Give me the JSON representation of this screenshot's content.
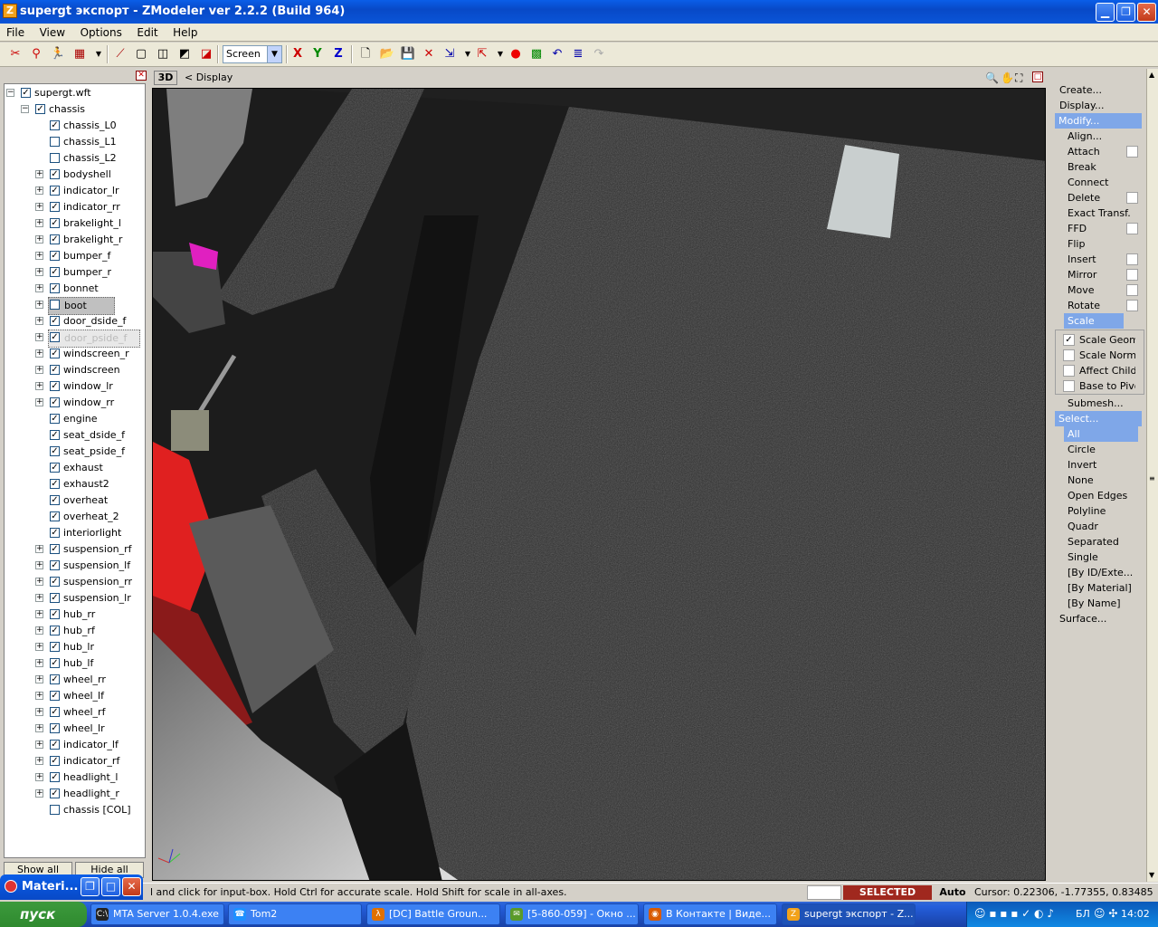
{
  "window": {
    "title": "supergt экспорт - ZModeler ver 2.2.2 (Build 964)",
    "icon_letter": "Z",
    "min_glyph": "▁",
    "max_glyph": "❐",
    "close_glyph": "✕"
  },
  "menu": [
    "File",
    "View",
    "Options",
    "Edit",
    "Help"
  ],
  "toolbar": {
    "view_select": "Screen",
    "axis_x": "X",
    "axis_y": "Y",
    "axis_z": "Z"
  },
  "tree": {
    "root": "supergt.wft",
    "chassis": "chassis",
    "items": [
      {
        "label": "chassis_L0",
        "checked": true,
        "expandable": false
      },
      {
        "label": "chassis_L1",
        "checked": false,
        "expandable": false
      },
      {
        "label": "chassis_L2",
        "checked": false,
        "expandable": false
      },
      {
        "label": "bodyshell",
        "checked": true,
        "expandable": true
      },
      {
        "label": "indicator_lr",
        "checked": true,
        "expandable": true
      },
      {
        "label": "indicator_rr",
        "checked": true,
        "expandable": true
      },
      {
        "label": "brakelight_l",
        "checked": true,
        "expandable": true
      },
      {
        "label": "brakelight_r",
        "checked": true,
        "expandable": true
      },
      {
        "label": "bumper_f",
        "checked": true,
        "expandable": true
      },
      {
        "label": "bumper_r",
        "checked": true,
        "expandable": true
      },
      {
        "label": "bonnet",
        "checked": true,
        "expandable": true
      },
      {
        "label": "boot",
        "checked": false,
        "expandable": true,
        "selected": true
      },
      {
        "label": "door_dside_f",
        "checked": true,
        "expandable": true
      },
      {
        "label": "door_pside_f",
        "checked": true,
        "expandable": true,
        "focused": true
      },
      {
        "label": "windscreen_r",
        "checked": true,
        "expandable": true
      },
      {
        "label": "windscreen",
        "checked": true,
        "expandable": true
      },
      {
        "label": "window_lr",
        "checked": true,
        "expandable": true
      },
      {
        "label": "window_rr",
        "checked": true,
        "expandable": true
      },
      {
        "label": "engine",
        "checked": true,
        "expandable": false
      },
      {
        "label": "seat_dside_f",
        "checked": true,
        "expandable": false
      },
      {
        "label": "seat_pside_f",
        "checked": true,
        "expandable": false
      },
      {
        "label": "exhaust",
        "checked": true,
        "expandable": false
      },
      {
        "label": "exhaust2",
        "checked": true,
        "expandable": false
      },
      {
        "label": "overheat",
        "checked": true,
        "expandable": false
      },
      {
        "label": "overheat_2",
        "checked": true,
        "expandable": false
      },
      {
        "label": "interiorlight",
        "checked": true,
        "expandable": false
      },
      {
        "label": "suspension_rf",
        "checked": true,
        "expandable": true
      },
      {
        "label": "suspension_lf",
        "checked": true,
        "expandable": true
      },
      {
        "label": "suspension_rr",
        "checked": true,
        "expandable": true
      },
      {
        "label": "suspension_lr",
        "checked": true,
        "expandable": true
      },
      {
        "label": "hub_rr",
        "checked": true,
        "expandable": true
      },
      {
        "label": "hub_rf",
        "checked": true,
        "expandable": true
      },
      {
        "label": "hub_lr",
        "checked": true,
        "expandable": true
      },
      {
        "label": "hub_lf",
        "checked": true,
        "expandable": true
      },
      {
        "label": "wheel_rr",
        "checked": true,
        "expandable": true
      },
      {
        "label": "wheel_lf",
        "checked": true,
        "expandable": true
      },
      {
        "label": "wheel_rf",
        "checked": true,
        "expandable": true
      },
      {
        "label": "wheel_lr",
        "checked": true,
        "expandable": true
      },
      {
        "label": "indicator_lf",
        "checked": true,
        "expandable": true
      },
      {
        "label": "indicator_rf",
        "checked": true,
        "expandable": true
      },
      {
        "label": "headlight_l",
        "checked": true,
        "expandable": true
      },
      {
        "label": "headlight_r",
        "checked": true,
        "expandable": true
      },
      {
        "label": "chassis [COL]",
        "checked": false,
        "expandable": false
      }
    ],
    "show_all": "Show all",
    "hide_all": "Hide all"
  },
  "viewport": {
    "mode": "3D",
    "label": "< Display"
  },
  "right_menu": {
    "create": "Create...",
    "display": "Display...",
    "modify": "Modify...",
    "modify_items": [
      {
        "label": "Align...",
        "has_box": false
      },
      {
        "label": "Attach",
        "has_box": true
      },
      {
        "label": "Break",
        "has_box": false
      },
      {
        "label": "Connect",
        "has_box": false
      },
      {
        "label": "Delete",
        "has_box": true
      },
      {
        "label": "Exact Transf...",
        "has_box": false
      },
      {
        "label": "FFD",
        "has_box": true
      },
      {
        "label": "Flip",
        "has_box": false
      },
      {
        "label": "Insert",
        "has_box": true
      },
      {
        "label": "Mirror",
        "has_box": true
      },
      {
        "label": "Move",
        "has_box": true
      },
      {
        "label": "Rotate",
        "has_box": true
      }
    ],
    "scale": "Scale",
    "scale_options": [
      {
        "label": "Scale Geometry",
        "checked": true
      },
      {
        "label": "Scale Normals",
        "checked": false
      },
      {
        "label": "Affect Children",
        "checked": false
      },
      {
        "label": "Base to Pivot",
        "checked": false
      }
    ],
    "submesh": "Submesh...",
    "select": "Select...",
    "select_items": [
      "All",
      "Circle",
      "Invert",
      "None",
      "Open Edges",
      "Polyline",
      "Quadr",
      "Separated",
      "Single",
      "[By ID/Exte...",
      "[By Material]",
      "[By Name]"
    ],
    "surface": "Surface..."
  },
  "status": {
    "hint": "l and click for input-box. Hold Ctrl for accurate scale. Hold Shift for scale in all-axes.",
    "mode": "SELECTED MODE",
    "auto": "Auto",
    "cursor": "Cursor: 0.22306, -1.77355, 0.83485"
  },
  "material_window": {
    "title": "Materi..."
  },
  "taskbar": {
    "start": "пуск",
    "tasks": [
      {
        "label": "MTA Server 1.0.4.exe",
        "icon": "C:\\",
        "color": "#222"
      },
      {
        "label": "Tom2",
        "icon": "☎",
        "color": "#1e90ff"
      },
      {
        "label": "[DC] Battle Groun...",
        "icon": "λ",
        "color": "#e07000"
      },
      {
        "label": "[5-860-059] - Окно ...",
        "icon": "✉",
        "color": "#5a9a2a"
      },
      {
        "label": "В Контакте | Виде...",
        "icon": "◉",
        "color": "#d85a00"
      },
      {
        "label": "supergt экспорт - Z...",
        "icon": "Z",
        "color": "#f2a21b",
        "active": true
      }
    ],
    "lang": "БЛ",
    "time": "14:02"
  },
  "colors": {
    "title_blue": "#0a5ee8",
    "highlight": "#7fa7e8",
    "mode_red": "#a0281e"
  }
}
